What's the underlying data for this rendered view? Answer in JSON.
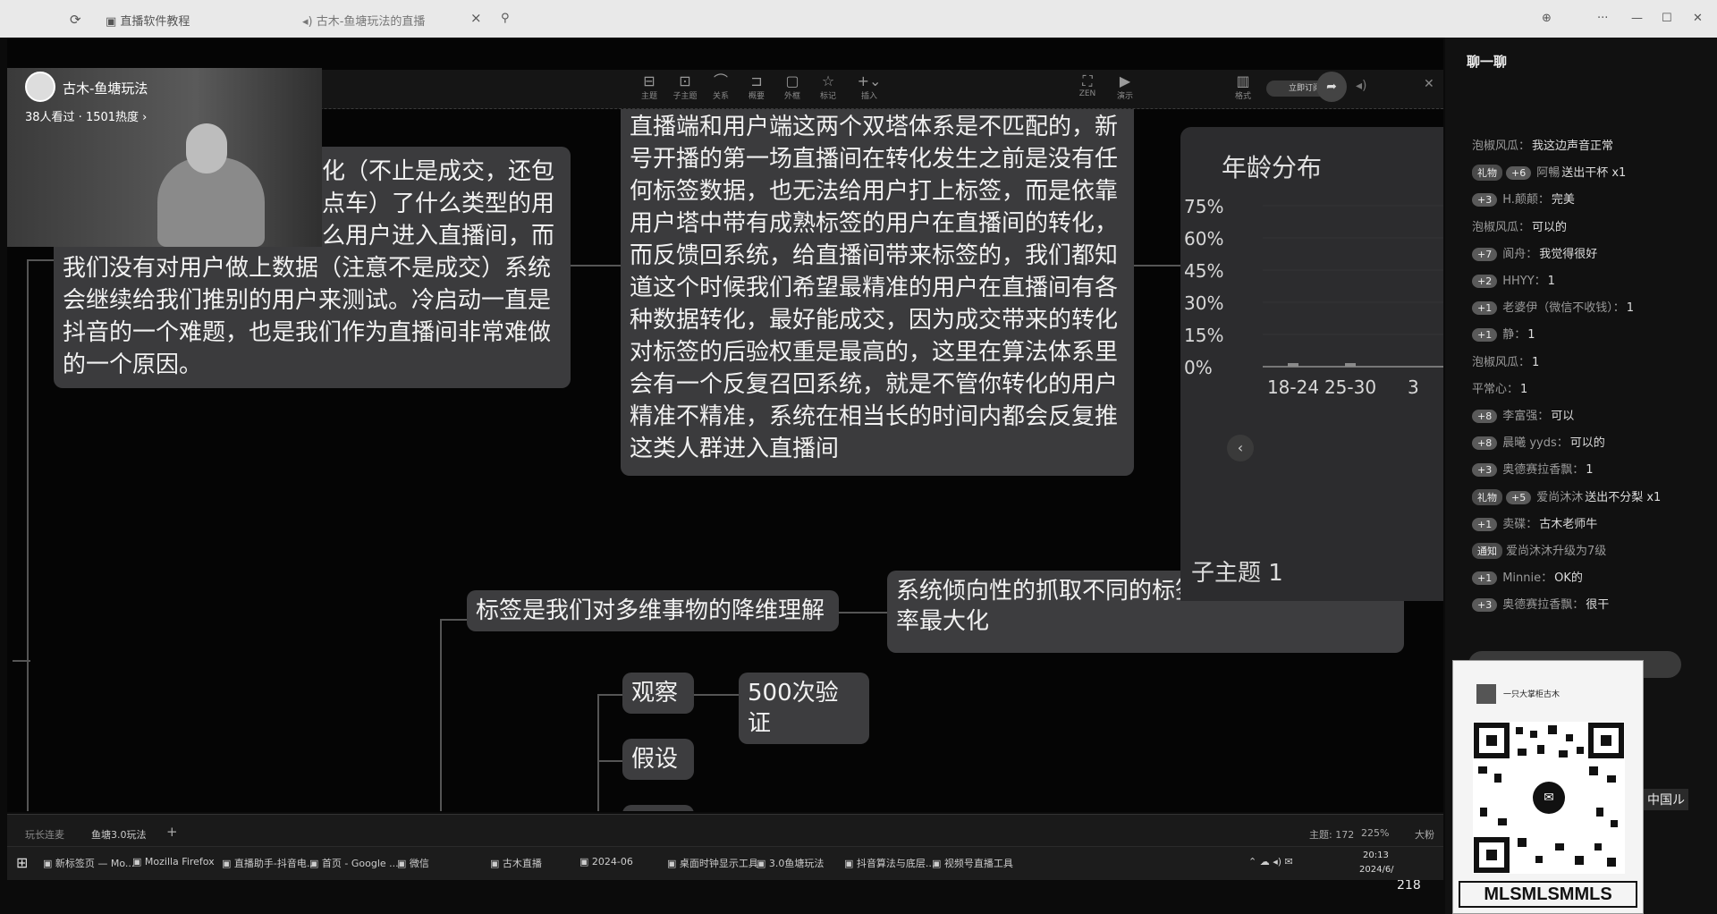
{
  "browser": {
    "tab1": "直播软件教程",
    "tab2": "古木-鱼塘玩法的直播",
    "close_glyph": "×",
    "minimize": "—",
    "maximize": "☐",
    "close": "✕",
    "more": "···"
  },
  "stream": {
    "host_name": "古木-鱼塘玩法",
    "viewers": "38人看过 · 1501热度 ›"
  },
  "toolbar": {
    "items": [
      "主题",
      "子主题",
      "关系",
      "概要",
      "外框",
      "标记",
      "插入",
      "ZEN",
      "演示",
      "格式"
    ],
    "share_label": "立即订阅"
  },
  "mindmap": {
    "node_left": [
      "化（不止是成交，还包",
      "点车）了什么类型的用",
      "么用户进入直播间，而",
      "我们没有对用户做上数据（注意不是成交）系统",
      "会继续给我们推别的用户来测试。冷启动一直是",
      "抖音的一个难题，也是我们作为直播间非常难做",
      "的一个原因。"
    ],
    "node_center": [
      "直播端和用户端这两个双塔体系是不匹配的，新",
      "号开播的第一场直播间在转化发生之前是没有任",
      "何标签数据，也无法给用户打上标签，而是依靠",
      "用户塔中带有成熟标签的用户在直播间的转化，",
      "而反馈回系统，给直播间带来标签的，我们都知",
      "道这个时候我们希望最精准的用户在直播间有各",
      "种数据转化，最好能成交，因为成交带来的转化",
      "对标签的后验权重是最高的，这里在算法体系里",
      "会有一个反复召回系统，就是不管你转化的用户",
      "精准不精准，系统在相当长的时间内都会反复推",
      "这类人群进入直播间"
    ],
    "node_tag": "标签是我们对多维事物的降维理解",
    "node_system": [
      "系统倾向性的抓取不同的标签换取信息匹配的效",
      "率最大化"
    ],
    "node_observe": "观察",
    "node_verify": "500次验证",
    "node_hypo": "假设",
    "subtopic": "子主题 1"
  },
  "chart_data": {
    "type": "bar",
    "title": "年龄分布",
    "yticks": [
      "75%",
      "60%",
      "45%",
      "30%",
      "15%",
      "0%"
    ],
    "categories": [
      "18-24",
      "25-30",
      "3"
    ],
    "ylim": [
      0,
      75
    ],
    "values": [
      1,
      1,
      0
    ]
  },
  "chat": {
    "title": "聊一聊",
    "messages": [
      {
        "badge": "",
        "level": "",
        "nick": "泡椒风瓜：",
        "text": "我这边声音正常"
      },
      {
        "badge": "礼物",
        "level": "+6",
        "nick": "阿暢",
        "text": "送出干杯 x1"
      },
      {
        "badge": "",
        "level": "+3",
        "nick": "H.颠颠：",
        "text": "完美"
      },
      {
        "badge": "",
        "level": "",
        "nick": "泡椒风瓜：",
        "text": "可以的"
      },
      {
        "badge": "",
        "level": "+7",
        "nick": "阆舟：",
        "text": "我觉得很好"
      },
      {
        "badge": "",
        "level": "+2",
        "nick": "HHYY：",
        "text": "1"
      },
      {
        "badge": "",
        "level": "+1",
        "nick": "老婆伊（微信不收钱）：",
        "text": "1"
      },
      {
        "badge": "",
        "level": "+1",
        "nick": "静：",
        "text": "1"
      },
      {
        "badge": "",
        "level": "",
        "nick": "泡椒风瓜：",
        "text": "1"
      },
      {
        "badge": "",
        "level": "",
        "nick": "平常心：",
        "text": "1"
      },
      {
        "badge": "",
        "level": "+8",
        "nick": "李富强：",
        "text": "可以"
      },
      {
        "badge": "",
        "level": "+8",
        "nick": "晨曦 yyds：",
        "text": "可以的"
      },
      {
        "badge": "",
        "level": "+3",
        "nick": "奥德赛拉香飘：",
        "text": "1"
      },
      {
        "badge": "礼物",
        "level": "+5",
        "nick": "爱尚沐沐",
        "text": "送出不分梨 x1"
      },
      {
        "badge": "",
        "level": "+1",
        "nick": "卖碟：",
        "text": "古木老师牛"
      },
      {
        "badge": "通知",
        "level": "",
        "nick": "爱尚沐沐升级为7级",
        "text": ""
      },
      {
        "badge": "",
        "level": "+1",
        "nick": "Minnie：",
        "text": "OK的"
      },
      {
        "badge": "",
        "level": "+3",
        "nick": "奥德赛拉香飘：",
        "text": "很干"
      }
    ],
    "qr_name": "一只大掌柜古木",
    "qr_caption": "MLSMLSMMLS",
    "side_caption": "中国ル",
    "like_count": "218"
  },
  "status": {
    "tab1": "玩长连麦",
    "tab2": "鱼塘3.0玩法",
    "add": "+",
    "topics": "主题: 172",
    "zoom": "225%",
    "size": "大粉"
  },
  "taskbar": {
    "items": [
      "新标签页 — Mo...",
      "Mozilla Firefox",
      "直播助手-抖音电...",
      "首页 - Google ...",
      "微信",
      "古木直播",
      "2024-06",
      "桌面时钟显示工具",
      "3.0鱼塘玩法",
      "抖音算法与底层...",
      "视频号直播工具"
    ],
    "time": "20:13",
    "date": "2024/6/"
  }
}
